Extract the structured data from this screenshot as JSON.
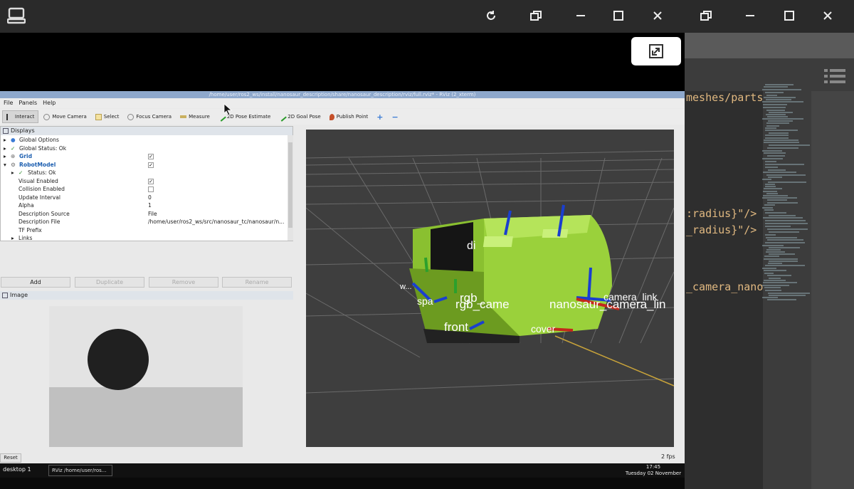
{
  "host": {
    "icons": [
      "computer-icon",
      "refresh-icon",
      "restore-icon",
      "minimize-icon",
      "maximize-icon",
      "close-icon",
      "popout-icon",
      "list-icon"
    ]
  },
  "rviz": {
    "title": "/home/user/ros2_ws/install/nanosaur_description/share/nanosaur_description/rviz/full.rviz* - RViz (2_xterm)",
    "menu": [
      "File",
      "Panels",
      "Help"
    ],
    "tools": [
      "Interact",
      "Move Camera",
      "Select",
      "Focus Camera",
      "Measure",
      "2D Pose Estimate",
      "2D Goal Pose",
      "Publish Point"
    ],
    "displays_title": "Displays",
    "display_rows": [
      {
        "label": "Global Options",
        "value": "",
        "check": ""
      },
      {
        "label": "Global Status: Ok",
        "value": "",
        "check": ""
      },
      {
        "label": "Grid",
        "value": "",
        "check": "✓"
      },
      {
        "label": "RobotModel",
        "value": "",
        "check": "✓"
      },
      {
        "label": "Status: Ok",
        "value": "",
        "check": ""
      },
      {
        "label": "Visual Enabled",
        "value": "",
        "check": "✓"
      },
      {
        "label": "Collision Enabled",
        "value": "",
        "check": " "
      },
      {
        "label": "Update Interval",
        "value": "0",
        "check": ""
      },
      {
        "label": "Alpha",
        "value": "1",
        "check": ""
      },
      {
        "label": "Description Source",
        "value": "File",
        "check": ""
      },
      {
        "label": "Description File",
        "value": "/home/user/ros2_ws/src/nanosaur_tc/nanosaur/n...",
        "check": ""
      },
      {
        "label": "TF Prefix",
        "value": "",
        "check": ""
      },
      {
        "label": "Links",
        "value": "",
        "check": ""
      }
    ],
    "buttons": [
      "Add",
      "Duplicate",
      "Remove",
      "Rename"
    ],
    "image_title": "Image",
    "reset": "Reset",
    "fps": "2 fps",
    "view_labels": [
      "di",
      "w...",
      "spa",
      "rgb_",
      "rgb_came",
      "nanosaur_camera_lin",
      "camera_link",
      "front",
      "cover"
    ]
  },
  "taskbar": {
    "desktop": "desktop 1",
    "task": "RViz /home/user/ros...",
    "time": "17:45",
    "date": "Tuesday 02 November"
  },
  "editor": {
    "lines": [
      "meshes/parts/",
      ":radius}\"/>",
      "_radius}\"/>",
      "_camera_nano"
    ]
  }
}
